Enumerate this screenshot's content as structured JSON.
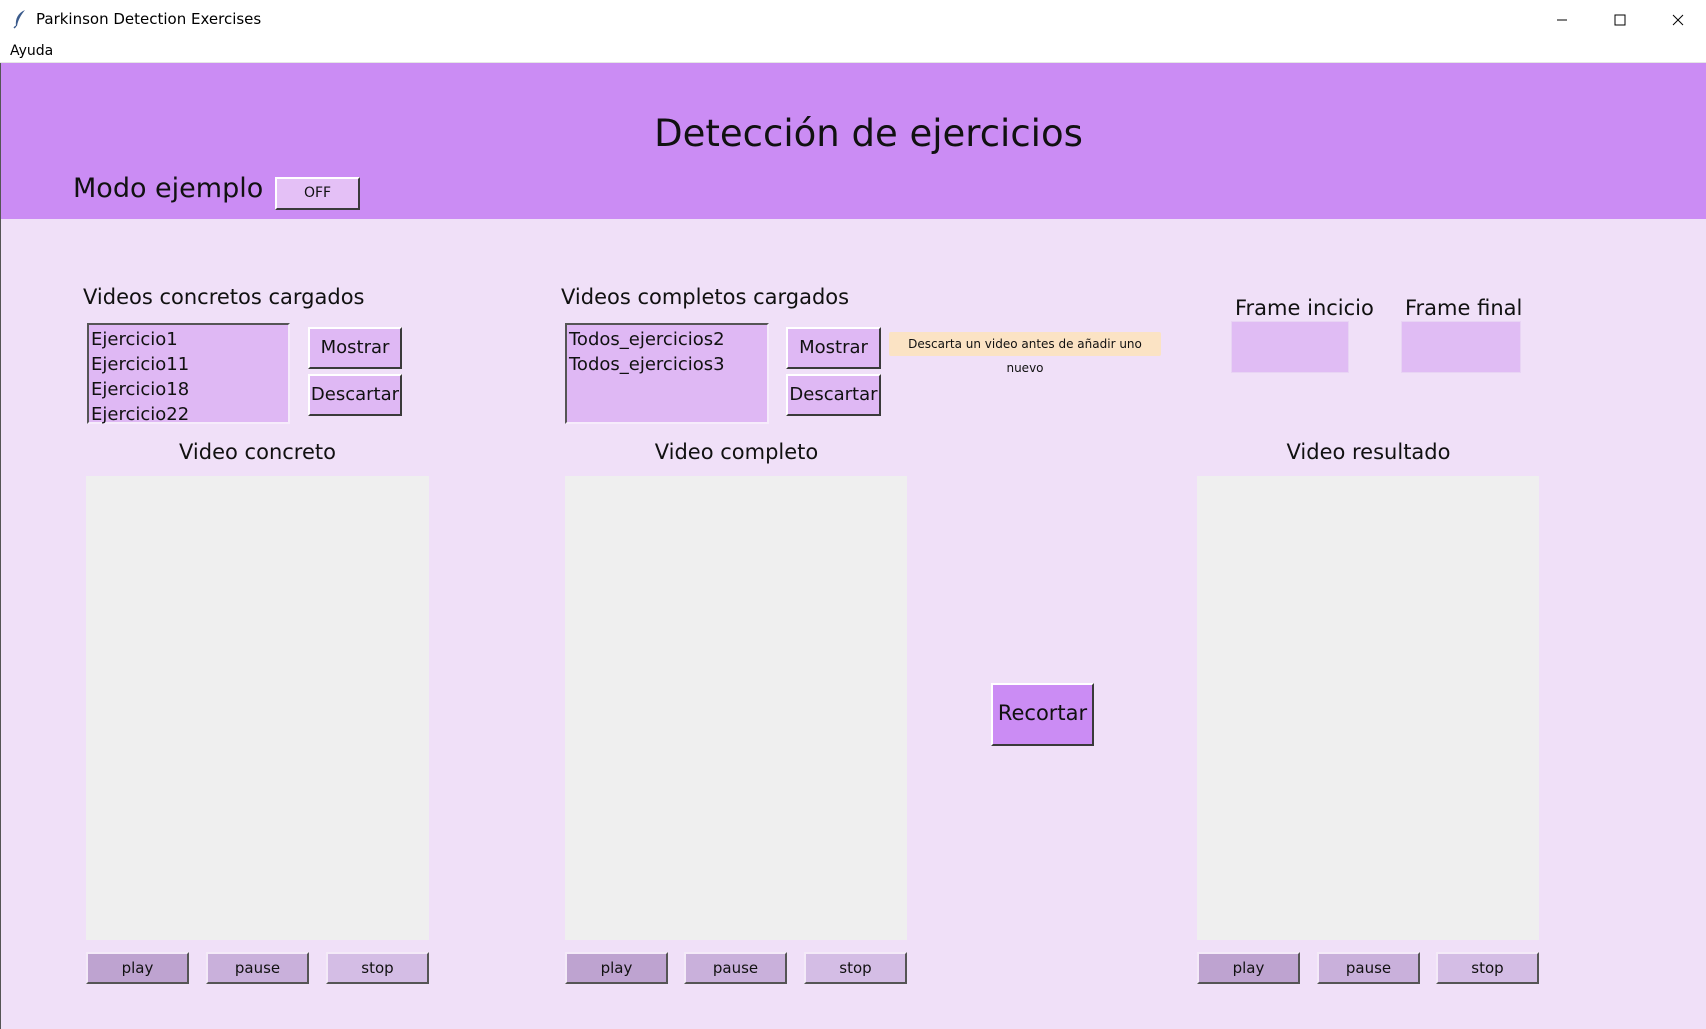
{
  "window": {
    "title": "Parkinson Detection Exercises",
    "icon": "feather-icon",
    "controls": [
      "minimize-icon",
      "maximize-icon",
      "close-icon"
    ]
  },
  "menu": {
    "items": [
      "Ayuda"
    ]
  },
  "header": {
    "title": "Detección de ejercicios",
    "mode_label": "Modo ejemplo",
    "mode_toggle": "OFF"
  },
  "concretos": {
    "label": "Videos concretos cargados",
    "items": [
      "Ejercicio1",
      "Ejercicio11",
      "Ejercicio18",
      "Ejercicio22"
    ],
    "show_label": "Mostrar",
    "discard_label": "Descartar"
  },
  "completos": {
    "label": "Videos completos cargados",
    "items": [
      "Todos_ejercicios2",
      "Todos_ejercicios3"
    ],
    "show_label": "Mostrar",
    "discard_label": "Descartar",
    "tooltip": "Descarta un video antes de añadir uno nuevo"
  },
  "frames": {
    "start_label": "Frame incicio",
    "end_label": "Frame final",
    "start_value": "",
    "end_value": ""
  },
  "videos": {
    "concreto": {
      "label": "Video concreto",
      "play": "play",
      "pause": "pause",
      "stop": "stop"
    },
    "completo": {
      "label": "Video completo",
      "play": "play",
      "pause": "pause",
      "stop": "stop"
    },
    "resultado": {
      "label": "Video resultado",
      "play": "play",
      "pause": "pause",
      "stop": "stop"
    }
  },
  "recortar_label": "Recortar",
  "colors": {
    "header_bg": "#cb8cf4",
    "content_bg": "#f0e0f8",
    "listbox_bg": "#dfb8f4",
    "tooltip_bg": "#fbe3c4",
    "video_bg": "#efefef"
  }
}
